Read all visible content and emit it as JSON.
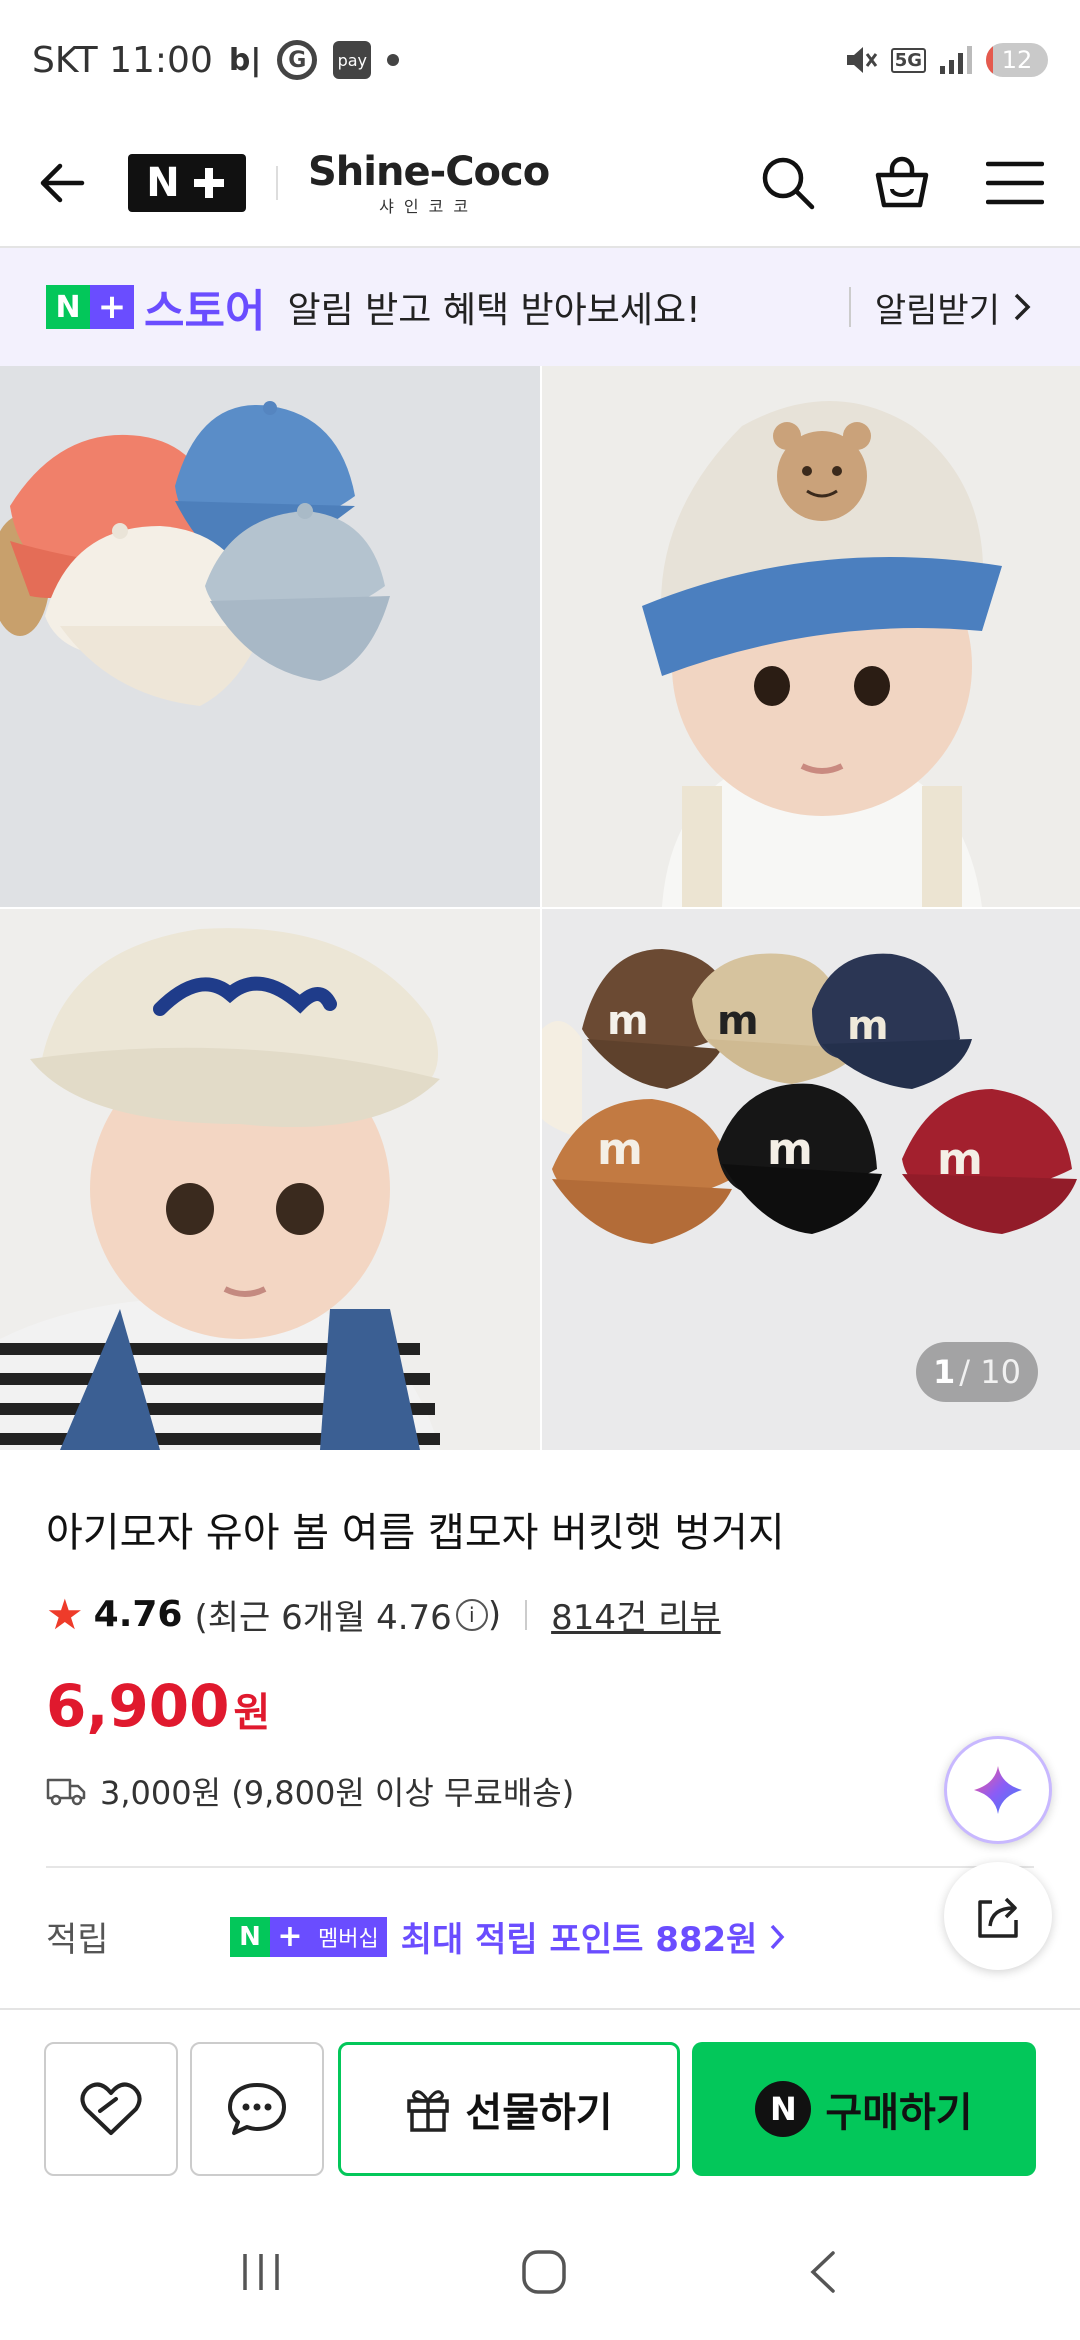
{
  "status_bar": {
    "carrier_time": "SKT 11:00",
    "app_b": "b|",
    "app_g": "G",
    "app_pay": "pay",
    "network": "5G",
    "battery": "12"
  },
  "header": {
    "back_icon": "arrow-left-icon",
    "nplus_label": "N",
    "shop_name": "Shine-Coco",
    "shop_name_kr": "샤인코코",
    "icons": [
      "search-icon",
      "cart-icon",
      "menu-icon"
    ]
  },
  "banner": {
    "badge_n": "N",
    "badge_plus": "+",
    "store_label": "스토어",
    "message": "알림 받고 혜택 받아보세요!",
    "action": "알림받기"
  },
  "gallery": {
    "current": "1",
    "total": "/ 10"
  },
  "product": {
    "title": "아기모자 유아 봄 여름 캡모자 버킷햇 벙거지",
    "rating": "4.76",
    "recent_rating": "(최근 6개월 4.76",
    "recent_close": ")",
    "reviews": "814건 리뷰",
    "price": "6,900",
    "price_unit": "원",
    "shipping": "3,000원 (9,800원 이상 무료배송)"
  },
  "points": {
    "label": "적립",
    "badge_member": "멤버십",
    "text": "최대 적립 포인트 882원"
  },
  "actions": {
    "gift": "선물하기",
    "buy": "구매하기",
    "buy_badge": "N"
  },
  "colors": {
    "naver_green": "#03c75a",
    "plus_purple": "#6a4dff",
    "price_red": "#e0192e",
    "star_red": "#ee3b2a"
  }
}
